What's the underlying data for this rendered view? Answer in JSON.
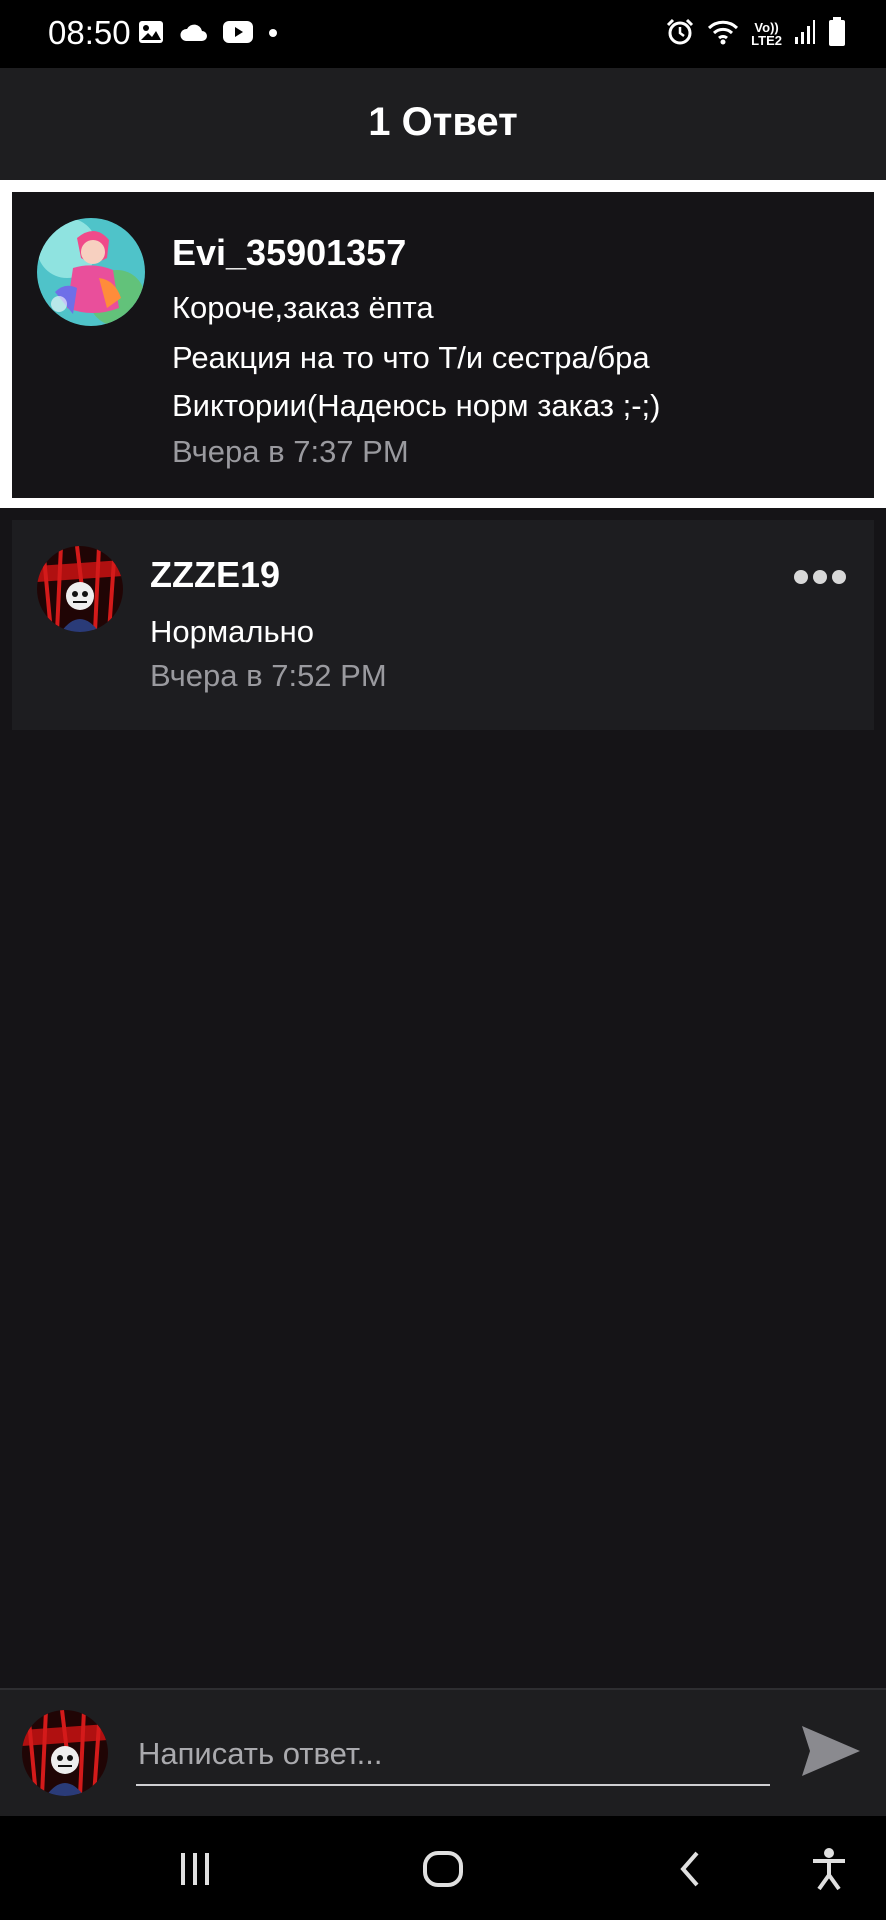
{
  "status_bar": {
    "time": "08:50",
    "network_label_top": "Vo))",
    "network_label_bottom": "LTE2",
    "icons": [
      "gallery-icon",
      "cloud-icon",
      "youtube-icon",
      "dot-icon",
      "alarm-icon",
      "wifi-icon",
      "signal-icon",
      "battery-icon"
    ]
  },
  "header": {
    "title": "1 Ответ"
  },
  "original_comment": {
    "username": "Evi_35901357",
    "lines": [
      "Короче,заказ ёпта",
      "Реакция на то что Т/и сестра/бра",
      "Виктории(Надеюсь норм заказ ;-;)"
    ],
    "timestamp": "Вчера в 7:37 PM"
  },
  "reply": {
    "username": "ZZZE19",
    "text": "Нормально",
    "timestamp": "Вчера в 7:52 PM"
  },
  "composer": {
    "placeholder": "Написать ответ..."
  },
  "colors": {
    "background": "#151417",
    "card": "#1d1d20",
    "header": "#1e1e20",
    "muted_text": "#9a9a9f"
  }
}
